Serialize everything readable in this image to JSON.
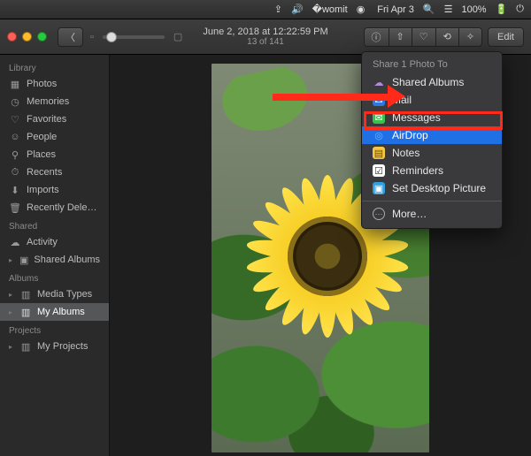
{
  "menubar": {
    "clock": "Fri Apr 3",
    "battery": "100%",
    "icons": [
      "up-arrow-icon",
      "volume-icon",
      "wifi-icon",
      "search-icon",
      "control-center-icon",
      "battery-icon",
      "power-icon"
    ]
  },
  "toolbar": {
    "title": "June 2, 2018 at 12:22:59 PM",
    "subtitle": "13 of 141",
    "edit_label": "Edit"
  },
  "sidebar": {
    "sections": [
      {
        "header": "Library",
        "items": [
          {
            "icon": "photos-icon",
            "label": "Photos"
          },
          {
            "icon": "memories-icon",
            "label": "Memories"
          },
          {
            "icon": "favorites-icon",
            "label": "Favorites"
          },
          {
            "icon": "people-icon",
            "label": "People"
          },
          {
            "icon": "places-icon",
            "label": "Places"
          },
          {
            "icon": "recents-icon",
            "label": "Recents"
          },
          {
            "icon": "imports-icon",
            "label": "Imports"
          },
          {
            "icon": "trash-icon",
            "label": "Recently Dele…"
          }
        ]
      },
      {
        "header": "Shared",
        "items": [
          {
            "icon": "activity-icon",
            "label": "Activity"
          },
          {
            "icon": "shared-albums-icon",
            "label": "Shared Albums",
            "disclosure": true
          }
        ]
      },
      {
        "header": "Albums",
        "items": [
          {
            "icon": "folder-icon",
            "label": "Media Types",
            "disclosure": true
          },
          {
            "icon": "folder-icon",
            "label": "My Albums",
            "disclosure": true,
            "selected": true
          }
        ]
      },
      {
        "header": "Projects",
        "items": [
          {
            "icon": "folder-icon",
            "label": "My Projects",
            "disclosure": true
          }
        ]
      }
    ]
  },
  "share_menu": {
    "title": "Share 1 Photo To",
    "items": [
      {
        "icon": "cloud-icon",
        "label": "Shared Albums"
      },
      {
        "icon": "mail-icon",
        "label": "Mail"
      },
      {
        "icon": "messages-icon",
        "label": "Messages"
      },
      {
        "icon": "airdrop-icon",
        "label": "AirDrop",
        "selected": true
      },
      {
        "icon": "notes-icon",
        "label": "Notes"
      },
      {
        "icon": "reminders-icon",
        "label": "Reminders"
      },
      {
        "icon": "desktop-icon",
        "label": "Set Desktop Picture"
      }
    ],
    "more_label": "More…"
  },
  "annotation": {
    "arrow_color": "#ff2a1a"
  }
}
